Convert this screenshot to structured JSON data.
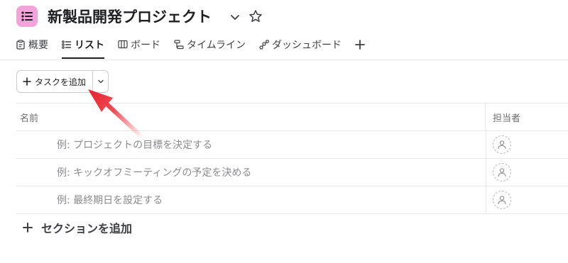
{
  "project": {
    "title": "新製品開発プロジェクト",
    "icon": "list-icon",
    "icon_bg": "#f2a3d9"
  },
  "tabs": [
    {
      "label": "概要",
      "icon": "clipboard-icon",
      "active": false
    },
    {
      "label": "リスト",
      "icon": "list-icon",
      "active": true
    },
    {
      "label": "ボード",
      "icon": "board-icon",
      "active": false
    },
    {
      "label": "タイムライン",
      "icon": "timeline-icon",
      "active": false
    },
    {
      "label": "ダッシュボード",
      "icon": "dashboard-icon",
      "active": false
    }
  ],
  "toolbar": {
    "add_task_label": "タスクを追加"
  },
  "table": {
    "columns": {
      "name": "名前",
      "assignee": "担当者"
    },
    "rows": [
      {
        "name": "例: プロジェクトの目標を決定する"
      },
      {
        "name": "例: キックオフミーティングの予定を決める"
      },
      {
        "name": "例: 最終期日を設定する"
      }
    ]
  },
  "add_section_label": "セクションを追加",
  "annotation": {
    "arrow_color": "#e8202a"
  }
}
